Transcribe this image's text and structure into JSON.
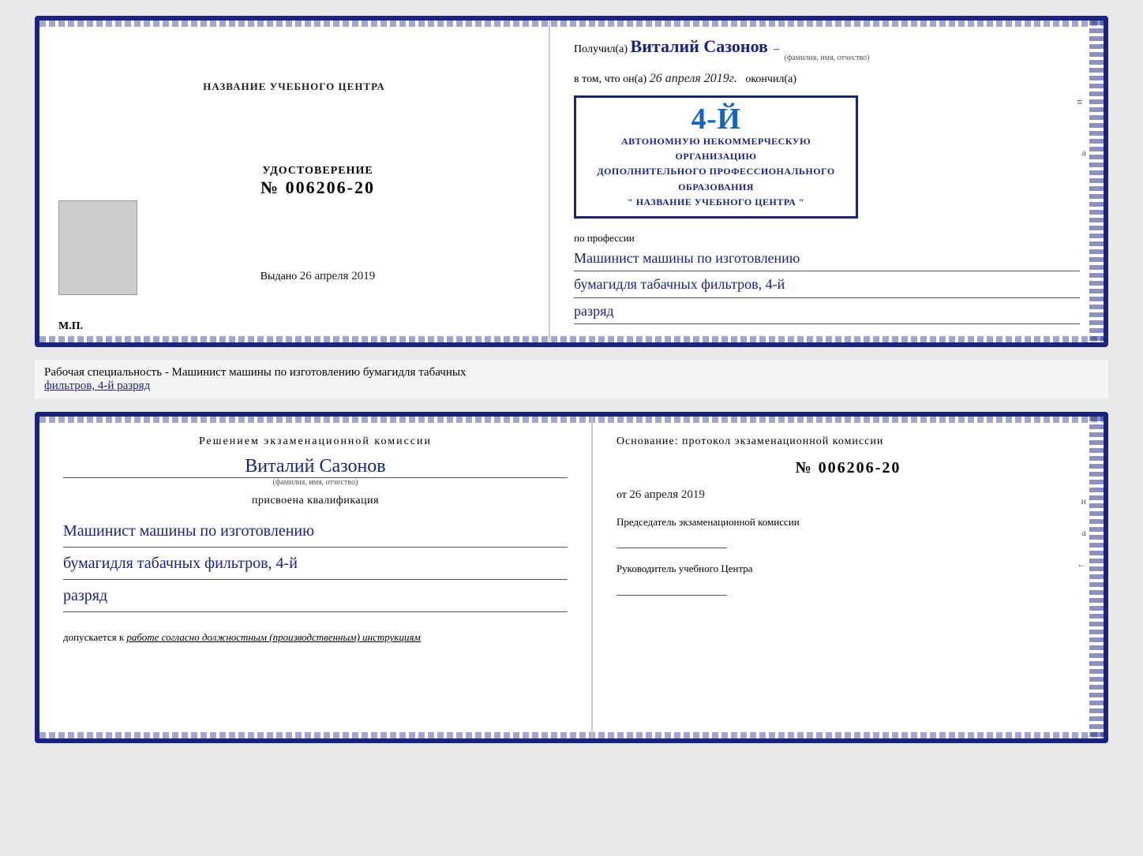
{
  "top_cert": {
    "left": {
      "title": "НАЗВАНИЕ УЧЕБНОГО ЦЕНТРА",
      "photo_alt": "фото",
      "udostoverenie_label": "УДОСТОВЕРЕНИЕ",
      "number": "№ 006206-20",
      "vydano_label": "Выдано",
      "vydano_date": "26 апреля 2019",
      "mp_label": "М.П."
    },
    "right": {
      "poluchil_prefix": "Получил(а)",
      "poluchil_name": "Виталий Сазонов",
      "poluchil_caption": "(фамилия, имя, отчество)",
      "vtom_prefix": "в том, что он(а)",
      "vtom_date": "26 апреля 2019г.",
      "okonchil": "окончил(а)",
      "stamp_number": "4-й",
      "stamp_line1": "АВТОНОМНУЮ НЕКОММЕРЧЕСКУЮ ОРГАНИЗАЦИЮ",
      "stamp_line2": "ДОПОЛНИТЕЛЬНОГО ПРОФЕССИОНАЛЬНОГО ОБРАЗОВАНИЯ",
      "stamp_line3": "\" НАЗВАНИЕ УЧЕБНОГО ЦЕНТРА \"",
      "profession_label": "по профессии",
      "profession_line1": "Машинист машины по изготовлению",
      "profession_line2": "бумагидля табачных фильтров, 4-й",
      "profession_line3": "разряд",
      "i_label": "и",
      "a_label": "а",
      "arrow_label": "←"
    }
  },
  "middle": {
    "text": "Рабочая специальность - Машинист машины по изготовлению бумагидля табачных",
    "text2_underline": "фильтров, 4-й разряд"
  },
  "bottom_cert": {
    "left": {
      "resheniem_title": "Решением экзаменационной комиссии",
      "name": "Виталий Сазонов",
      "name_caption": "(фамилия, имя, отчество)",
      "prisvoena": "присвоена квалификация",
      "qual_line1": "Машинист машины по изготовлению",
      "qual_line2": "бумагидля табачных фильтров, 4-й",
      "qual_line3": "разряд",
      "dopuskaetsya_prefix": "допускается к",
      "dopuskaetsya_text": "работе согласно должностным (производственным) инструкциям"
    },
    "right": {
      "osnovanie": "Основание: протокол экзаменационной комиссии",
      "number": "№ 006206-20",
      "ot_prefix": "от",
      "ot_date": "26 апреля 2019",
      "predsedatel_label": "Председатель экзаменационной комиссии",
      "rukovoditel_label": "Руководитель учебного Центра",
      "i_label": "и",
      "a_label": "а",
      "arrow_label": "←"
    }
  }
}
